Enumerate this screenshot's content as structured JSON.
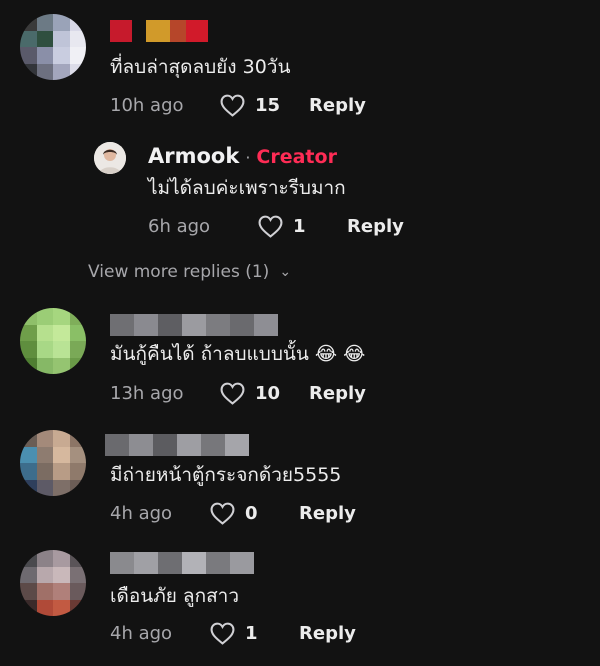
{
  "comments": [
    {
      "text": "ที่ลบล่าสุดลบยัง 30วัน",
      "time": "10h ago",
      "likes": "15",
      "reply_label": "Reply",
      "avatar_colors": [
        "#3a3a3a",
        "#6c7a85",
        "#9aa3b8",
        "#d9d9e8",
        "#4a6a6a",
        "#2f4f3f",
        "#bfc4d8",
        "#e8e8f0",
        "#5a5a6a",
        "#8a8fa8",
        "#c9cde0",
        "#f0f0f5",
        "#33353a",
        "#6d7080",
        "#a3a6bd",
        "#dcdce8"
      ],
      "name_colors": [
        "#c61a2c",
        "#121212",
        "#d19a2a",
        "#b6462a",
        "#d11a2a"
      ]
    },
    {
      "text": "มันกู้คืนได้ ถ้าลบแบบนั้น 😂 😂",
      "time": "13h ago",
      "likes": "10",
      "reply_label": "Reply",
      "avatar_colors": [
        "#8fbf6a",
        "#9bcd76",
        "#a6d67f",
        "#7fae5a",
        "#6f9e4a",
        "#b6e08e",
        "#c4e99a",
        "#8abf66",
        "#5f8e3e",
        "#a8d886",
        "#b9e395",
        "#7aa957",
        "#4f7e32",
        "#86b866",
        "#95c471",
        "#6a9a48"
      ],
      "name_colors": [
        "#6f6f73",
        "#8a8a90",
        "#5e5e62",
        "#9b9ba0",
        "#7c7c80",
        "#6a6a6e",
        "#8e8e94"
      ]
    },
    {
      "text": "มีถ่ายหน้าตู้กระจกด้วย5555",
      "time": "4h ago",
      "likes": "0",
      "reply_label": "Reply",
      "avatar_colors": [
        "#6a5d55",
        "#a48a7a",
        "#c8aa92",
        "#8c7566",
        "#4b8fb0",
        "#8e7c70",
        "#d6b89e",
        "#a5907f",
        "#3d6d8c",
        "#7b6c62",
        "#b89c86",
        "#8f7a6b",
        "#2e3f5c",
        "#5d5a66",
        "#7e6f68",
        "#6b5d56"
      ],
      "name_colors": [
        "#6a6a6e",
        "#8d8d92",
        "#5c5c60",
        "#9e9ea3",
        "#77777b",
        "#a5a5aa"
      ]
    },
    {
      "text": "เดือนภัย ลูกสาว",
      "time": "4h ago",
      "likes": "1",
      "reply_label": "Reply",
      "avatar_colors": [
        "#4a4a4e",
        "#8c8288",
        "#a89aa0",
        "#5a5458",
        "#6e6a70",
        "#b8a8ac",
        "#c9b8ba",
        "#7a7074",
        "#5c4a48",
        "#a07068",
        "#b0807a",
        "#6a5a5c",
        "#3a2a2a",
        "#b04a38",
        "#c25a42",
        "#6a3a34"
      ],
      "name_colors": [
        "#8a8a8e",
        "#a0a0a5",
        "#6e6e72",
        "#b2b2b7",
        "#7a7a7e",
        "#9a9a9f"
      ]
    }
  ],
  "reply": {
    "author": "Armook",
    "separator": "·",
    "badge": "Creator",
    "text": "ไม่ได้ลบค่ะเพราะรีบมาก",
    "time": "6h ago",
    "likes": "1",
    "reply_label": "Reply",
    "badge_color": "#fe2c55"
  },
  "view_more": {
    "label": "View more replies (1)",
    "chevron": "⌄"
  }
}
